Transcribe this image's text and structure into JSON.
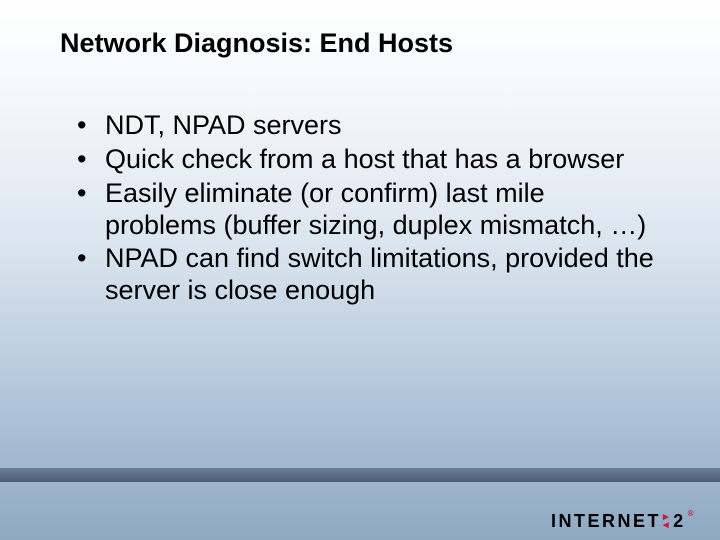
{
  "slide": {
    "title": "Network Diagnosis: End Hosts",
    "bullets": [
      "NDT, NPAD servers",
      "Quick check from a host that has a browser",
      "Easily eliminate (or confirm) last mile problems (buffer sizing, duplex mismatch, …)",
      "NPAD can find switch limitations, provided the server is close enough"
    ],
    "logo": {
      "left": "INTERNET",
      "right": "2",
      "reg": "®"
    }
  }
}
